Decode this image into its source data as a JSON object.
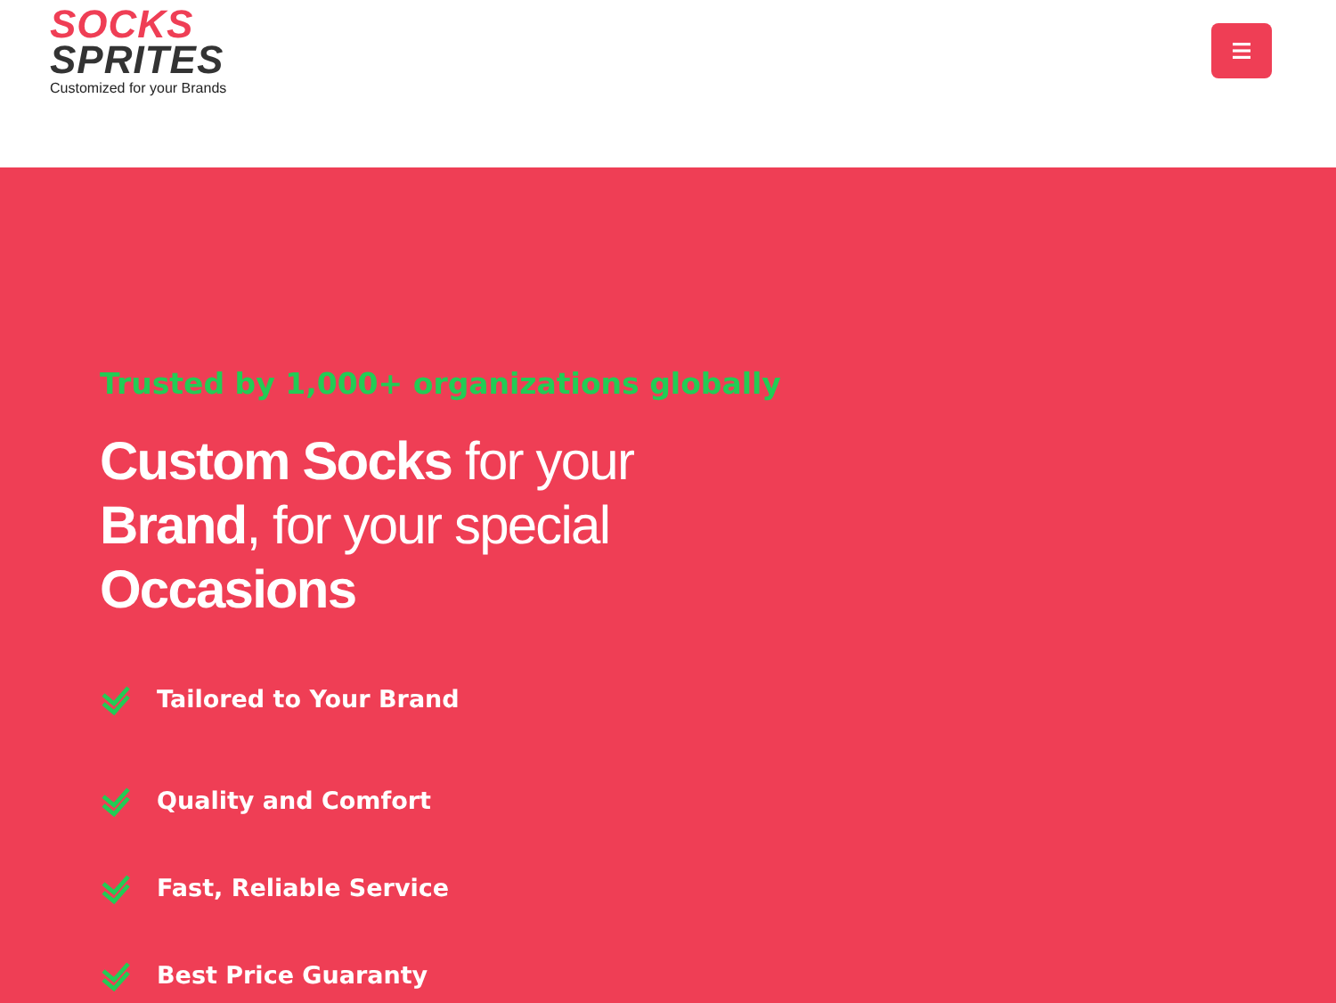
{
  "header": {
    "logo": {
      "line_1": "SOCKS",
      "line_2": "SPRITES",
      "tagline": "Customized for your Brands"
    }
  },
  "hero": {
    "eyebrow": "Trusted by 1,000+ organizations globally",
    "heading": "**Custom Socks** for your **Brand**, for your special **Occasions**",
    "features": [
      "Tailored to Your Brand",
      "Quality and Comfort",
      "Fast, Reliable Service",
      "Best Price Guaranty"
    ]
  }
}
